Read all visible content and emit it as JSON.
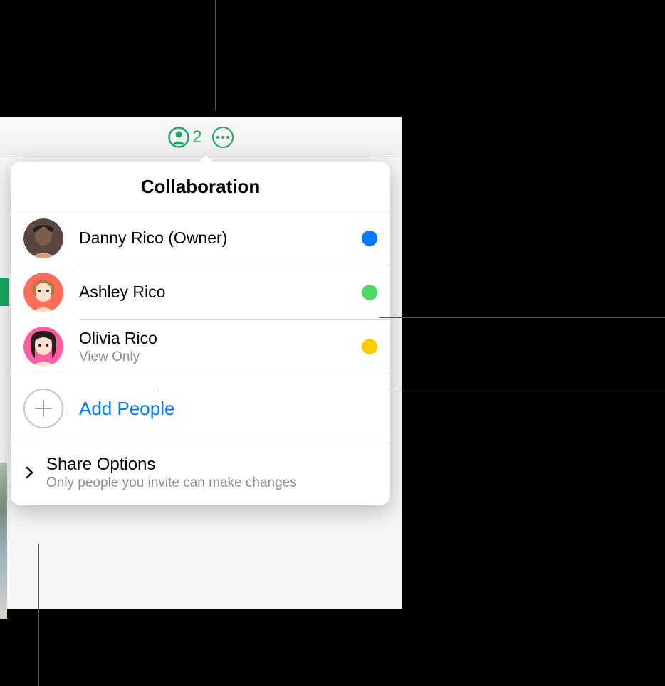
{
  "accent_color": "#1aa85f",
  "link_color": "#007aff",
  "toolbar": {
    "collab_count": "2"
  },
  "popover": {
    "title": "Collaboration",
    "people": [
      {
        "name": "Danny Rico (Owner)",
        "sub": "",
        "dot_color": "#007aff",
        "avatar_bg": "#5a4640",
        "avatar_skin": "#7a5d4a"
      },
      {
        "name": "Ashley Rico",
        "sub": "",
        "dot_color": "#4cd964",
        "avatar_bg": "#ff6d5a",
        "avatar_skin": "#ffdfc9"
      },
      {
        "name": "Olivia Rico",
        "sub": "View Only",
        "dot_color": "#ffcc00",
        "avatar_bg": "#ff5da2",
        "avatar_skin": "#ffe0d0"
      }
    ],
    "add_people": "Add People",
    "share": {
      "title": "Share Options",
      "sub": "Only people you invite can make changes"
    }
  }
}
